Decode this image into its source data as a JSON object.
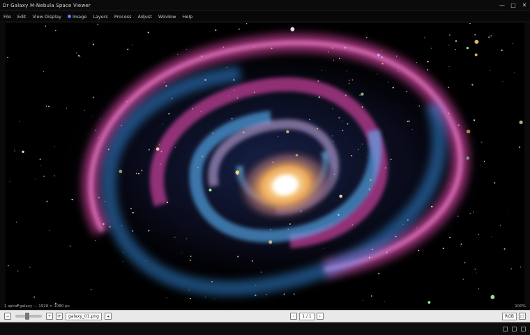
{
  "window": {
    "title": "Dr Galaxy M-Nebula Space Viewer",
    "controls": {
      "minimize": "—",
      "maximize": "□",
      "close": "✕"
    }
  },
  "toolbar": {
    "items": [
      {
        "label": "File",
        "icon": "document-icon"
      },
      {
        "label": "Edit",
        "icon": "pencil-icon"
      },
      {
        "label": "View Display",
        "icon": "eye-icon"
      },
      {
        "label": "Image",
        "icon": "image-icon"
      },
      {
        "label": "Layers",
        "icon": "layers-icon"
      },
      {
        "label": "Process",
        "icon": "gear-icon"
      },
      {
        "label": "Adjust",
        "icon": "sliders-icon"
      },
      {
        "label": "Window",
        "icon": "window-icon"
      },
      {
        "label": "Help",
        "icon": "help-icon"
      }
    ]
  },
  "caption": {
    "left": "1 spiral galaxy — 1920 × 1080 px",
    "right": "100%"
  },
  "statusbar": {
    "zoom_value": "100%",
    "file_field": "galaxy_01.png",
    "page_field": "1 / 1",
    "right_field": "RGB"
  },
  "taskbar": {
    "label": ""
  },
  "colors": {
    "arm_pink": "#ff4fc0",
    "arm_blue": "#3aa0ff",
    "core": "#ffd08a",
    "space": "#000000"
  }
}
